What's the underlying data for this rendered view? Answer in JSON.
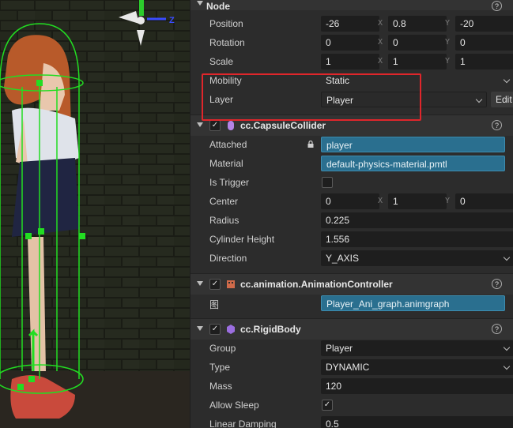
{
  "node": {
    "header": "Node",
    "position": {
      "label": "Position",
      "x": "-26",
      "y": "0.8",
      "z": "-20"
    },
    "rotation": {
      "label": "Rotation",
      "x": "0",
      "y": "0",
      "z": "0"
    },
    "scale": {
      "label": "Scale",
      "x": "1",
      "y": "1",
      "z": "1"
    },
    "mobility": {
      "label": "Mobility",
      "value": "Static"
    },
    "layer": {
      "label": "Layer",
      "value": "Player",
      "edit": "Edit"
    }
  },
  "axes": {
    "x": "X",
    "y": "Y"
  },
  "capsule": {
    "title": "cc.CapsuleCollider",
    "attached": {
      "label": "Attached",
      "value": "player"
    },
    "material": {
      "label": "Material",
      "value": "default-physics-material.pmtl"
    },
    "is_trigger": {
      "label": "Is Trigger"
    },
    "center": {
      "label": "Center",
      "x": "0",
      "y": "1",
      "z": "0"
    },
    "radius": {
      "label": "Radius",
      "value": "0.225"
    },
    "cylinder_height": {
      "label": "Cylinder Height",
      "value": "1.556"
    },
    "direction": {
      "label": "Direction",
      "value": "Y_AXIS"
    }
  },
  "anim": {
    "title": "cc.animation.AnimationController",
    "graph": {
      "label": "图",
      "value": "Player_Ani_graph.animgraph"
    }
  },
  "rigid": {
    "title": "cc.RigidBody",
    "group": {
      "label": "Group",
      "value": "Player"
    },
    "type": {
      "label": "Type",
      "value": "DYNAMIC"
    },
    "mass": {
      "label": "Mass",
      "value": "120"
    },
    "allow_sleep": {
      "label": "Allow Sleep"
    },
    "linear_damping": {
      "label": "Linear Damping",
      "value": "0.5"
    }
  },
  "help_glyph": "?",
  "check_glyph": "✓",
  "gizmo": {
    "z_label": "Z"
  },
  "colors": {
    "accent": "#2a6f8f",
    "highlight": "#e0262b",
    "collider": "#22dd22"
  }
}
